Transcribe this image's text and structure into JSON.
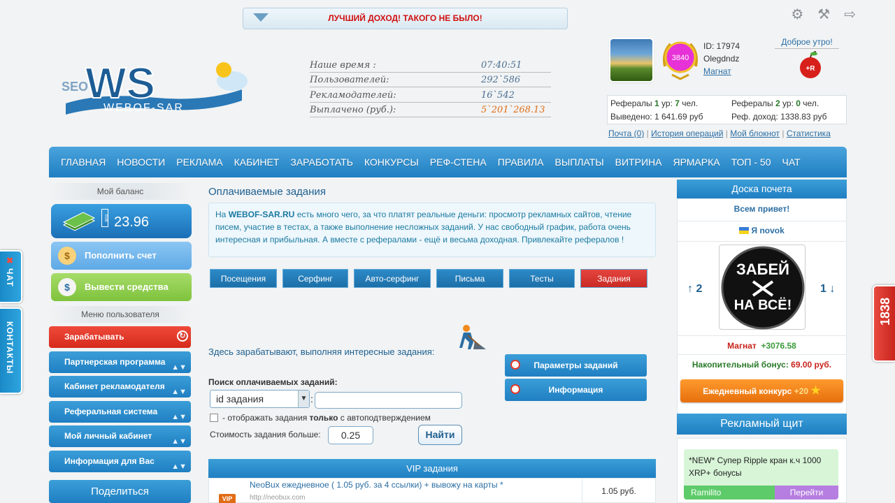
{
  "banner": {
    "text": "ЛУЧШИЙ ДОХОД! ТАКОГО НЕ БЫЛО!"
  },
  "logo": {
    "seo": "SEO",
    "ws": "WS",
    "name": "WEBOF-SAR"
  },
  "stats": [
    {
      "label": "Наше время :",
      "value": "07:40:51"
    },
    {
      "label": "Пользователей:",
      "value": "292`586"
    },
    {
      "label": "Рекламодателей:",
      "value": "16`542"
    },
    {
      "label": "Выплачено (руб.):",
      "value": "5`201`268.13"
    }
  ],
  "user": {
    "level": "3840",
    "id": "ID: 17974",
    "name": "Olegdndz",
    "status": "Магнат",
    "greeting": "Доброе утро!",
    "apple_label": "+R"
  },
  "referrals": {
    "l1_label": "Рефералы",
    "l1_level": "1",
    "l1_mid": "ур:",
    "l1_count": "7",
    "l1_unit": "чел.",
    "l2_label": "Рефералы",
    "l2_level": "2",
    "l2_mid": "ур:",
    "l2_count": "0",
    "l2_unit": "чел.",
    "withdrawn_label": "Выведено:",
    "withdrawn": "1 641.69 руб",
    "ref_income_label": "Реф. доход:",
    "ref_income": "1338.83 руб"
  },
  "user_links": [
    "Почта (0)",
    "История операций",
    "Мой блокнот",
    "Статистика"
  ],
  "nav": [
    "ГЛАВНАЯ",
    "НОВОСТИ",
    "РЕКЛАМА",
    "КАБИНЕТ",
    "ЗАРАБОТАТЬ",
    "КОНКУРСЫ",
    "РЕФ-СТЕНА",
    "ПРАВИЛА",
    "ВЫПЛАТЫ",
    "ВИТРИНА",
    "ЯРМАРКА",
    "ТОП - 50",
    "ЧАТ"
  ],
  "sidebar": {
    "balance_title": "Мой баланс",
    "balance": "23.96",
    "balance_icon_text": "RUB",
    "topup": "Пополнить счет",
    "withdraw": "Вывести средства",
    "menu_title": "Меню пользователя",
    "menu": [
      "Зарабатывать",
      "Партнерская программа",
      "Кабинет рекламодателя",
      "Реферальная система",
      "Мой личный кабинет",
      "Информация для Вас"
    ],
    "share": "Поделиться"
  },
  "main": {
    "title": "Оплачиваемые задания",
    "info_pre": "На ",
    "info_site": "WEBOF-SAR.RU",
    "info_post": " есть много чего, за что платят реальные деньги: просмотр рекламных сайтов, чтение писем, участие в тестах, а также выполнение несложных заданий. У нас свободный график, работа очень интересная и прибыльная. А вместе с рефералами - ещё и весьма доходная. Привлекайте рефералов !",
    "tabs": [
      "Посещения",
      "Серфинг",
      "Авто-серфинг",
      "Письма",
      "Тесты",
      "Задания"
    ],
    "earn_text": "Здесь зарабатывают, выполняя интересные задания:",
    "params_btn": "Параметры заданий",
    "info_btn": "Информация",
    "search_label": "Поиск оплачиваемых заданий:",
    "search_select": "id задания",
    "search_input": "",
    "colon": ":",
    "checkbox_pre": "- отображать задания ",
    "checkbox_bold": "только",
    "checkbox_post": " с автоподтверждением",
    "cost_label": "Стоимость задания больше:",
    "cost_value": "0.25",
    "find_btn": "Найти",
    "vip_header": "VIP задания",
    "vip_rows": [
      {
        "badge": "VIP",
        "title": "NeoBux ежедневное ( 1.05 руб. за 4 ссылки) + вывожу на карты *",
        "url": "http://neobux.com",
        "price": "1.05 руб."
      }
    ]
  },
  "right": {
    "honor_title": "Доска почета",
    "honor_greeting": "Всем привет!",
    "honor_user": "Я novok",
    "honor_pic_line1": "ЗАБЕЙ",
    "honor_pic_line2": "НА ВСЁ!",
    "up_count": "↑ 2",
    "down_count": "1 ↓",
    "honor_status": "Магнат",
    "honor_bonus": "+3076.58",
    "accum_label": "Накопительный бонус:",
    "accum_value": "69.00 руб.",
    "contest_label": "Ежедневный конкурс",
    "contest_bonus": "+20",
    "ad_title": "Рекламный щит",
    "ad_text": "*NEW* Супер Ripple кран к.ч 1000 XRP+ бонусы",
    "ad_user": "Ramilito",
    "ad_go": "Перейти"
  },
  "side_tabs": {
    "chat": "ЧАТ",
    "contacts": "КОНТАКТЫ",
    "counter": "1838"
  },
  "colors": {
    "accent": "#1f7fc2",
    "red": "#d01010",
    "green": "#8cc63f",
    "orange": "#e6700c"
  }
}
